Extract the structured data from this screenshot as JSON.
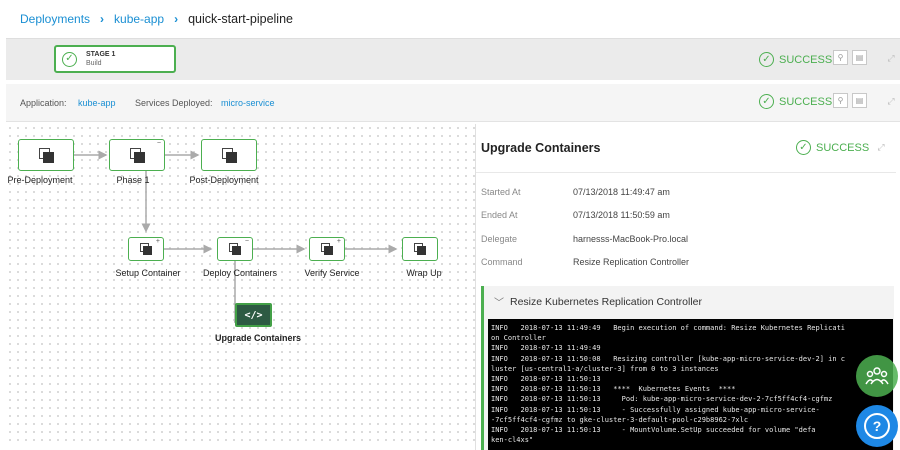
{
  "breadcrumb": [
    "Deployments",
    "kube-app",
    "quick-start-pipeline"
  ],
  "stage": {
    "stage_label": "STAGE 1",
    "stage_name": "Build",
    "status": "SUCCESS"
  },
  "app_info": {
    "application_label": "Application:",
    "application_value": "kube-app",
    "services_label": "Services Deployed:",
    "services_value": "micro-service",
    "status": "SUCCESS"
  },
  "workflow": {
    "phases": [
      "Pre-Deployment",
      "Phase 1",
      "Post-Deployment"
    ],
    "steps": [
      "Setup Container",
      "Deploy Containers",
      "Verify Service",
      "Wrap Up"
    ],
    "command": {
      "label": "Upgrade Containers",
      "glyph": "</>"
    }
  },
  "details": {
    "title": "Upgrade Containers",
    "status": "SUCCESS",
    "rows": [
      {
        "key": "Started At",
        "value": "07/13/2018 11:49:47 am"
      },
      {
        "key": "Ended At",
        "value": "07/13/2018 11:50:59 am"
      },
      {
        "key": "Delegate",
        "value": "harnesss-MacBook-Pro.local"
      },
      {
        "key": "Command",
        "value": "Resize Replication Controller"
      }
    ]
  },
  "log": {
    "title": "Resize Kubernetes Replication Controller",
    "lines": [
      "INFO   2018-07-13 11:49:49   Begin execution of command: Resize Kubernetes Replicati",
      "on Controller",
      "INFO   2018-07-13 11:49:49",
      "INFO   2018-07-13 11:50:08   Resizing controller [kube-app-micro-service-dev-2] in c",
      "luster [us-central1-a/cluster-3] from 0 to 3 instances",
      "INFO   2018-07-13 11:50:13",
      "INFO   2018-07-13 11:50:13   ****  Kubernetes Events  ****",
      "INFO   2018-07-13 11:50:13     Pod: kube-app-micro-service-dev-2-7cf5ff4cf4-cgfmz",
      "INFO   2018-07-13 11:50:13     - Successfully assigned kube-app-micro-service-",
      "-7cf5ff4cf4-cgfmz to gke-cluster-3-default-pool-c29b8962-7xlc",
      "INFO   2018-07-13 11:50:13     - MountVolume.SetUp succeeded for volume \"defa",
      "ken-cl4xs\""
    ]
  },
  "help": {
    "glyph": "?"
  }
}
